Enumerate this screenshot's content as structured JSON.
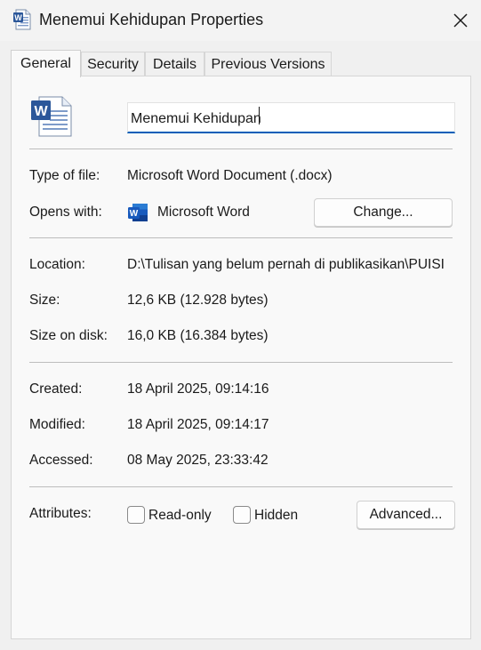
{
  "window": {
    "title": "Menemui Kehidupan Properties"
  },
  "tabs": [
    {
      "label": "General",
      "active": true
    },
    {
      "label": "Security",
      "active": false
    },
    {
      "label": "Details",
      "active": false
    },
    {
      "label": "Previous Versions",
      "active": false
    }
  ],
  "general": {
    "file_name": "Menemui Kehidupan",
    "type_label": "Type of file:",
    "type_value": "Microsoft Word Document (.docx)",
    "opens_label": "Opens with:",
    "opens_value": "Microsoft Word",
    "change_button": "Change...",
    "location_label": "Location:",
    "location_value": "D:\\Tulisan yang belum pernah di publikasikan\\PUISI",
    "size_label": "Size:",
    "size_value": "12,6 KB (12.928 bytes)",
    "size_disk_label": "Size on disk:",
    "size_disk_value": "16,0 KB (16.384 bytes)",
    "created_label": "Created:",
    "created_value": "18 April 2025, 09:14:16",
    "modified_label": "Modified:",
    "modified_value": "18 April 2025, 09:14:17",
    "accessed_label": "Accessed:",
    "accessed_value": "08 May 2025, 23:33:42",
    "attributes_label": "Attributes:",
    "readonly_label": "Read-only",
    "readonly_checked": false,
    "hidden_label": "Hidden",
    "hidden_checked": false,
    "advanced_button": "Advanced..."
  },
  "colors": {
    "word_blue": "#2b579a",
    "focus_underline": "#005fb8"
  },
  "icons": {
    "title": "word-document-icon",
    "close": "close-icon",
    "file": "word-document-icon",
    "opens_with": "microsoft-word-icon"
  }
}
